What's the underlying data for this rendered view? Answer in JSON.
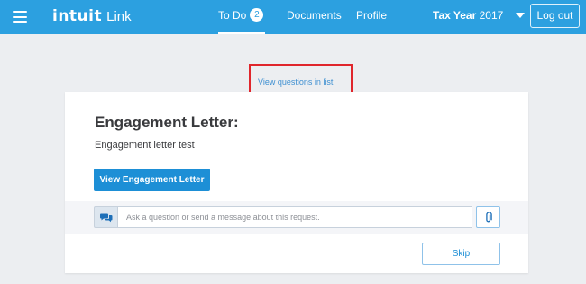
{
  "header": {
    "brand": {
      "wordmark": "intuit",
      "product": "Link"
    },
    "nav": {
      "todo_label": "To Do",
      "todo_count": "2",
      "documents_label": "Documents",
      "profile_label": "Profile"
    },
    "tax_year": {
      "prefix": "Tax Year",
      "year": "2017"
    },
    "logout_label": "Log out",
    "icons": {
      "menu": "hamburger-menu-icon",
      "tax_year_toggle": "caret-down-icon"
    }
  },
  "main": {
    "view_questions_link": "View questions in list",
    "card": {
      "title": "Engagement Letter:",
      "description": "Engagement letter test",
      "primary_button": "View Engagement Letter",
      "message": {
        "placeholder": "Ask a question or send a message about this request.",
        "value": "",
        "icons": {
          "chat": "chat-bubbles-icon",
          "attach": "paperclip-icon"
        }
      },
      "skip_label": "Skip"
    }
  },
  "colors": {
    "header_bg": "#2ca0e0",
    "page_bg": "#eceef1",
    "primary": "#1d8fd6",
    "link": "#3d8fd1",
    "highlight_border": "#e0262c",
    "text": "#393a3d"
  }
}
